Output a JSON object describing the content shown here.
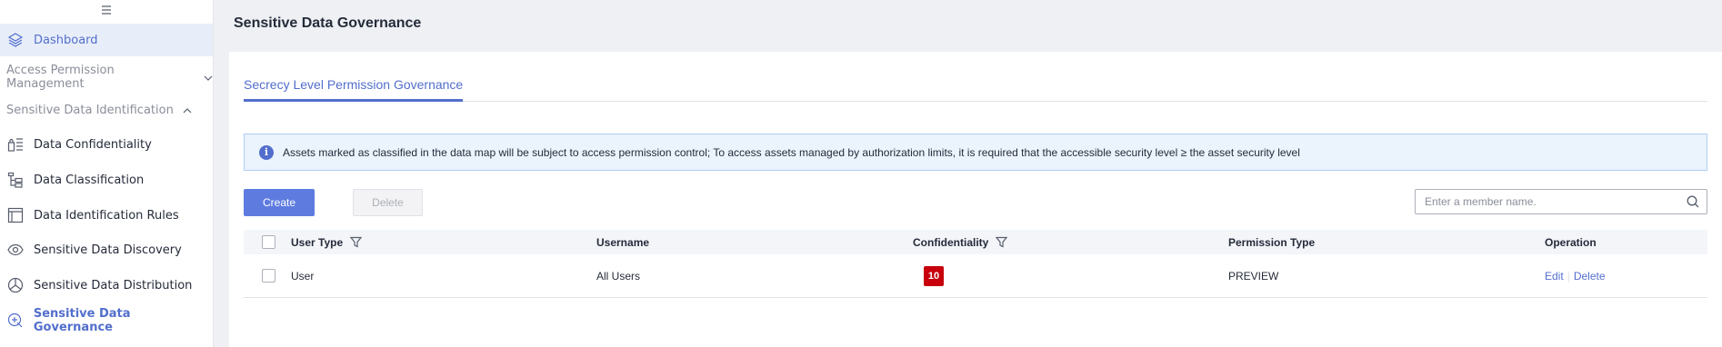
{
  "sidebar": {
    "dashboard": "Dashboard",
    "access_group": "Access Permission Management",
    "sensitive_group": "Sensitive Data Identification",
    "items": [
      {
        "label": "Data Confidentiality"
      },
      {
        "label": "Data Classification"
      },
      {
        "label": "Data Identification Rules"
      },
      {
        "label": "Sensitive Data Discovery"
      },
      {
        "label": "Sensitive Data Distribution"
      },
      {
        "label": "Sensitive Data Governance"
      }
    ]
  },
  "header": {
    "title": "Sensitive Data Governance"
  },
  "tabs": [
    {
      "label": "Secrecy Level Permission Governance"
    }
  ],
  "alert": {
    "text": "Assets marked as classified in the data map will be subject to access permission control; To access assets managed by authorization limits, it is required that the accessible security level ≥ the asset security level"
  },
  "toolbar": {
    "create_label": "Create",
    "delete_label": "Delete",
    "search_placeholder": "Enter a member name."
  },
  "table": {
    "columns": [
      "User Type",
      "Username",
      "Confidentiality",
      "Permission Type",
      "Operation"
    ],
    "rows": [
      {
        "user_type": "User",
        "username": "All Users",
        "confidentiality": "10",
        "permission_type": "PREVIEW",
        "edit": "Edit",
        "delete": "Delete"
      }
    ]
  },
  "colors": {
    "accent": "#526ecc",
    "primary_button": "#5e7ce0",
    "confidentiality_badge": "#c7000b"
  }
}
